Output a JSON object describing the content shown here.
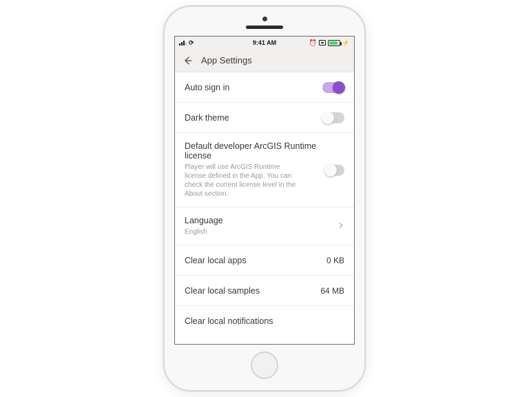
{
  "status_bar": {
    "time": "9:41 AM",
    "carrier_glyph": "⟳"
  },
  "header": {
    "title": "App Settings"
  },
  "rows": {
    "auto_sign_in": {
      "label": "Auto sign in",
      "on": true
    },
    "dark_theme": {
      "label": "Dark theme",
      "on": false
    },
    "runtime_license": {
      "label": "Default developer ArcGIS Runtime license",
      "sub": "Player will use ArcGIS Runtime license defined in the App. You can check the current license level in the About section.",
      "on": false
    },
    "language": {
      "label": "Language",
      "value": "English"
    },
    "clear_apps": {
      "label": "Clear local apps",
      "value": "0 KB"
    },
    "clear_samples": {
      "label": "Clear local samples",
      "value": "64 MB"
    },
    "clear_notifications": {
      "label": "Clear local notifications"
    }
  }
}
